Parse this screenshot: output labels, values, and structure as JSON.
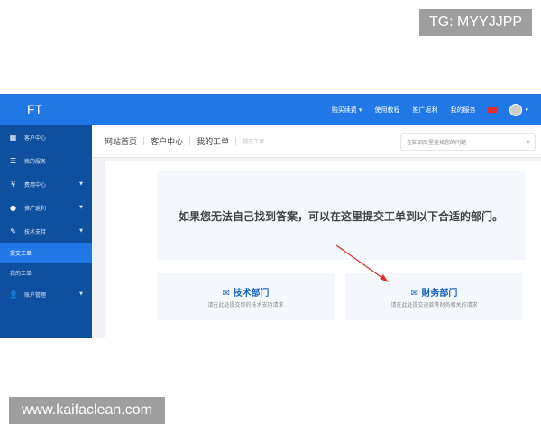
{
  "watermarks": {
    "top": "TG: MYYJJPP",
    "bottom": "www.kaifaclean.com"
  },
  "header": {
    "logo": "FT",
    "nav": [
      {
        "label": "购买续费",
        "dropdown": true
      },
      {
        "label": "使用教程"
      },
      {
        "label": "推广返利"
      },
      {
        "label": "我的服务"
      }
    ]
  },
  "sidebar": {
    "items": [
      {
        "label": "客户中心",
        "icon": "grid-icon"
      },
      {
        "label": "我的服务",
        "icon": "server-icon"
      },
      {
        "label": "费用中心",
        "icon": "yen-icon",
        "dropdown": true
      },
      {
        "label": "推广返利",
        "icon": "share-icon",
        "dropdown": true
      },
      {
        "label": "技术支持",
        "icon": "pencil-icon",
        "dropdown": true
      }
    ],
    "sub_items": [
      {
        "label": "提交工单",
        "active": true
      },
      {
        "label": "我的工单"
      }
    ],
    "account": {
      "label": "账户管理",
      "icon": "user-icon"
    }
  },
  "breadcrumb": [
    "网站首页",
    "客户中心",
    "我的工单",
    "提交工单"
  ],
  "search": {
    "placeholder": "在知识库里查找您的问题"
  },
  "main": {
    "hero": "如果您无法自己找到答案，可以在这里提交工单到以下合适的部门。",
    "cards": [
      {
        "title": "技术部门",
        "desc": "请在此处提交你的技术支持请求"
      },
      {
        "title": "财务部门",
        "desc": "请在此处提交退款等财务相关的请求"
      }
    ]
  },
  "colors": {
    "header": "#1f78e6",
    "sidebar": "#0e4f9f",
    "accent": "#1763c0",
    "arrow": "#d9342b"
  }
}
